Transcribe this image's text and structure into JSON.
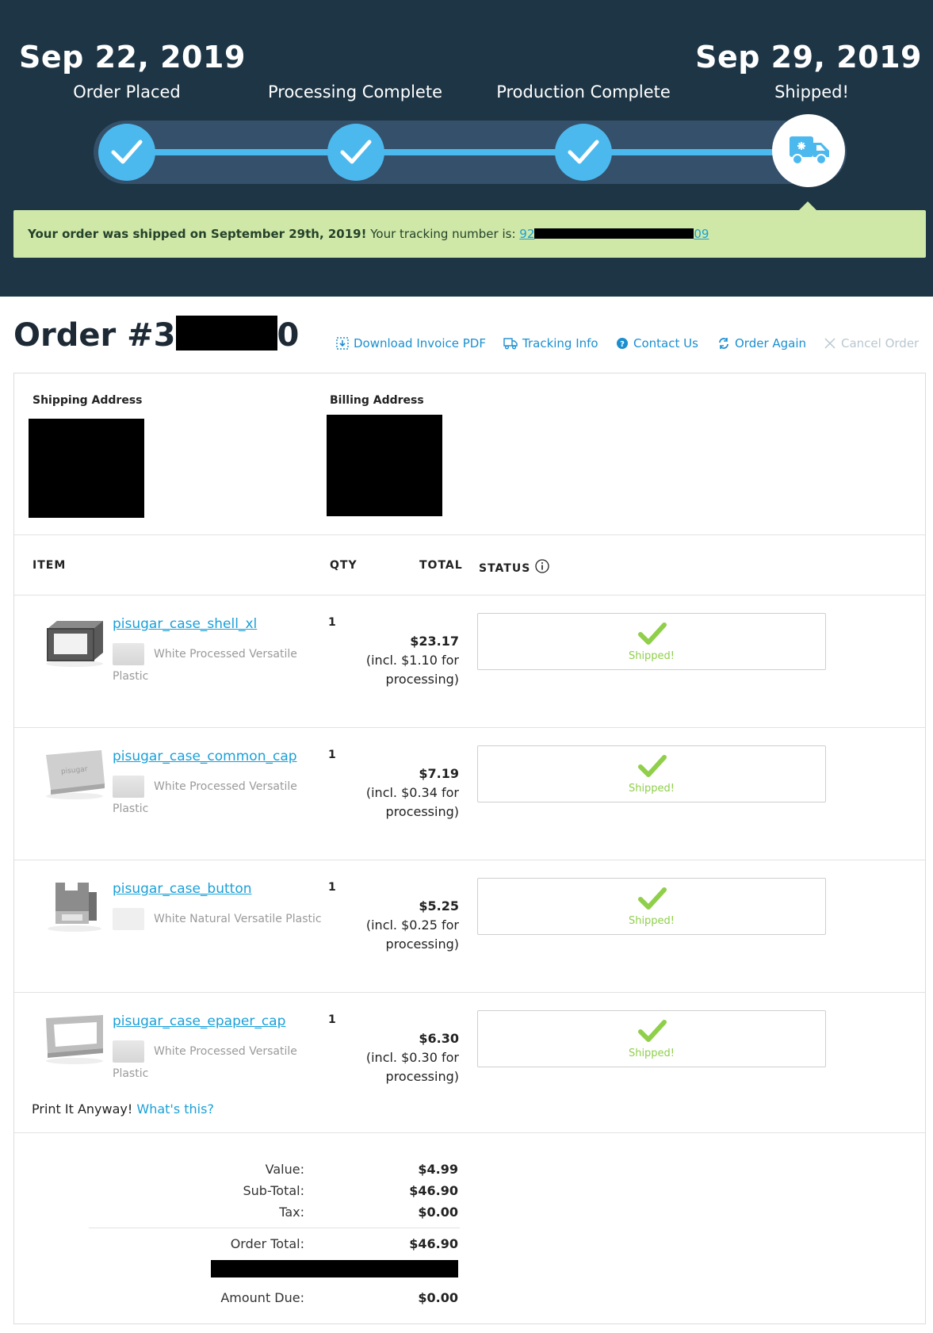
{
  "progress": {
    "start_date": "Sep 22, 2019",
    "end_date": "Sep 29, 2019",
    "steps": [
      {
        "label": "Order Placed",
        "done": true
      },
      {
        "label": "Processing Complete",
        "done": true
      },
      {
        "label": "Production Complete",
        "done": true
      },
      {
        "label": "Shipped!",
        "done": false
      }
    ],
    "banner_bold": "Your order was shipped on September 29th, 2019!",
    "banner_text": " Your tracking number is: ",
    "tracking_prefix": "92",
    "tracking_suffix": "09"
  },
  "order": {
    "title_prefix": "Order #3",
    "title_suffix": "0",
    "actions": [
      {
        "label": "Download Invoice PDF",
        "icon": "download-icon"
      },
      {
        "label": "Tracking Info",
        "icon": "truck-icon"
      },
      {
        "label": "Contact Us",
        "icon": "help-icon"
      },
      {
        "label": "Order Again",
        "icon": "refresh-icon"
      },
      {
        "label": "Cancel Order",
        "icon": "close-icon",
        "disabled": true
      }
    ]
  },
  "addresses": {
    "shipping_label": "Shipping Address",
    "billing_label": "Billing Address"
  },
  "table": {
    "headers": [
      "ITEM",
      "QTY",
      "TOTAL",
      "STATUS"
    ],
    "rows": [
      {
        "name": "pisugar_case_shell_xl",
        "material": "White Processed Versatile Plastic",
        "qty": "1",
        "total": "$23.17",
        "note": "(incl. $1.10 for processing)",
        "status": "Shipped!"
      },
      {
        "name": "pisugar_case_common_cap",
        "material": "White Processed Versatile Plastic",
        "qty": "1",
        "total": "$7.19",
        "note": "(incl. $0.34 for processing)",
        "status": "Shipped!"
      },
      {
        "name": "pisugar_case_button",
        "material": "White Natural Versatile Plastic",
        "qty": "1",
        "total": "$5.25",
        "note": "(incl. $0.25 for processing)",
        "status": "Shipped!"
      },
      {
        "name": "pisugar_case_epaper_cap",
        "material": "White Processed Versatile Plastic",
        "qty": "1",
        "total": "$6.30",
        "note": "(incl. $0.30 for processing)",
        "status": "Shipped!"
      }
    ],
    "print_anyway": "Print It Anyway!",
    "whats_this": "What's this?"
  },
  "totals": {
    "value_label": "Value:",
    "value": "$4.99",
    "subtotal_label": "Sub-Total:",
    "subtotal": "$46.90",
    "tax_label": "Tax:",
    "tax": "$0.00",
    "order_total_label": "Order Total:",
    "order_total": "$46.90",
    "amount_due_label": "Amount Due:",
    "amount_due": "$0.00"
  },
  "colors": {
    "header_bg": "#1d3545",
    "accent": "#4cb9ee",
    "banner_bg": "#cfe8a8",
    "link": "#1aa0d8",
    "shipped_green": "#8fcf4a"
  }
}
